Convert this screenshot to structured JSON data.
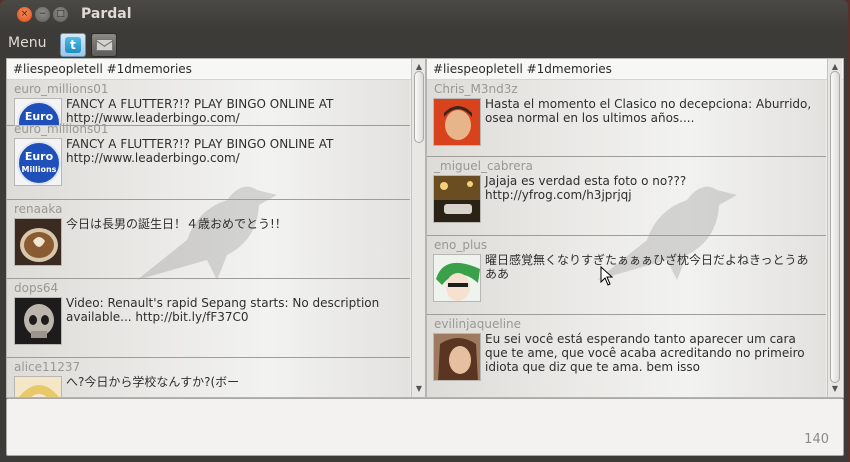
{
  "window": {
    "title": "Pardal",
    "close_glyph": "×",
    "minimize_glyph": "−",
    "maximize_glyph": "□"
  },
  "toolbar": {
    "menu_label": "Menu",
    "tabs": [
      {
        "icon": "twitter-icon",
        "active": true
      },
      {
        "icon": "mail-icon",
        "active": false
      }
    ]
  },
  "columns": [
    {
      "header": "#liespeopletell #1dmemories",
      "tweets": [
        {
          "user": "euro_millions01",
          "text": "FANCY A FLUTTER?!? PLAY BINGO ONLINE AT http://www.leaderbingo.com/",
          "avatar": "euro-millions-logo"
        },
        {
          "user": "euro_millions01",
          "text": "FANCY A FLUTTER?!? PLAY BINGO ONLINE AT http://www.leaderbingo.com/",
          "avatar": "euro-millions-logo"
        },
        {
          "user": "renaaka",
          "text": "今日は長男の誕生日！４歳おめでとう!！",
          "avatar": "coffee-cup-photo"
        },
        {
          "user": "dops64",
          "text": "Video: Renault's rapid Sepang starts: No description available... http://bit.ly/fF37C0",
          "avatar": "skull-photo"
        },
        {
          "user": "alice11237",
          "text": "へ?今日から学校なんすか?(ボー",
          "avatar": "anime-girl-photo"
        }
      ]
    },
    {
      "header": "#liespeopletell #1dmemories",
      "tweets": [
        {
          "user": "Chris_M3nd3z",
          "text": "Hasta el momento el Clasico no decepciona: Aburrido, osea normal en los ultimos años....",
          "avatar": "face-photo"
        },
        {
          "user": "_miguel_cabrera",
          "text": "Jajaja es verdad esta foto o no??? http://yfrog.com/h3jprjqj",
          "avatar": "car-night-photo"
        },
        {
          "user": "eno_plus",
          "text": "曜日感覚無くなりすぎたぁぁぁひざ枕今日だよねきっとうあああ",
          "avatar": "anime-boy-photo"
        },
        {
          "user": "evilinjaqueline",
          "text": "Eu sei você está esperando tanto aparecer um cara que te ame, que você acaba acreditando no primeiro idiota que diz que te ama. bem isso",
          "avatar": "girl-portrait-photo"
        }
      ]
    }
  ],
  "compose": {
    "counter": "140"
  },
  "colors": {
    "window_bg": "#3c3b37",
    "close_button": "#df4a16",
    "column_bg": "#ecebe8",
    "username": "#9a9894",
    "tweet_text": "#2e2e2e"
  }
}
